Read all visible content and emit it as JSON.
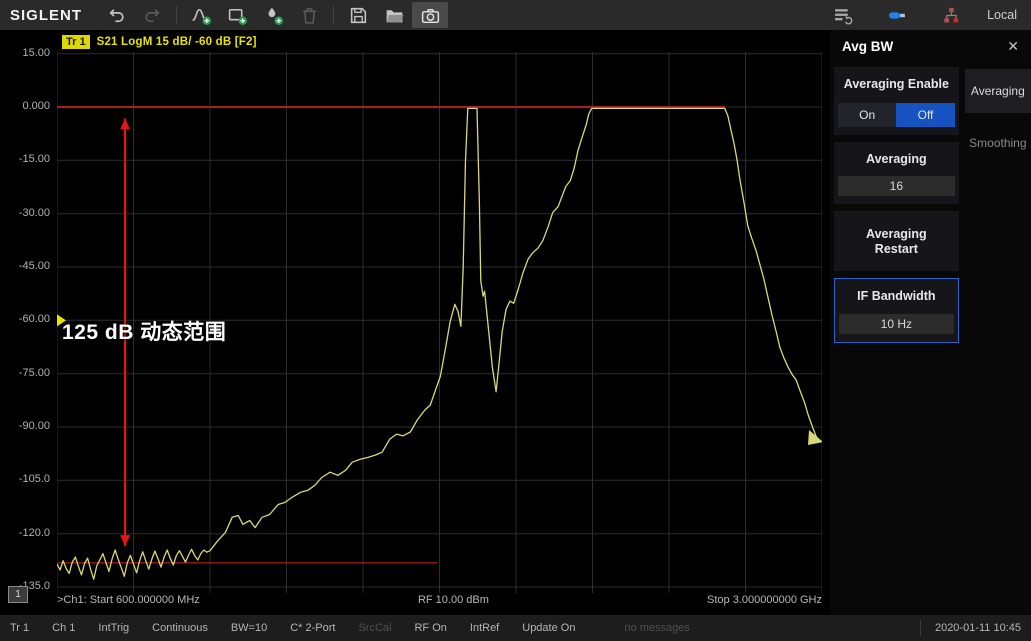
{
  "window": {
    "brand": "SIGLENT",
    "local_label": "Local"
  },
  "toolbar": {
    "icons": [
      "undo",
      "redo",
      "add-trace",
      "add-window",
      "add-marker",
      "delete",
      "save",
      "open-file",
      "screenshot"
    ],
    "right_icons": [
      "system-setup",
      "usb",
      "lan-error"
    ]
  },
  "trace_info": {
    "badge": "Tr 1",
    "text": "S21 LogM 15 dB/ -60 dB [F2]"
  },
  "plot": {
    "y_ticks": [
      "15.00",
      "0.000",
      "-15.00",
      "-30.00",
      "-45.00",
      "-60.00",
      "-75.00",
      "-90.00",
      "-105.0",
      "-120.0",
      "-135.0"
    ],
    "annotation_label": "125 dB 动态范围",
    "channel_badge": "1",
    "footer": {
      "start": ">Ch1: Start 600.000000 MHz",
      "power": "RF 10.00 dBm",
      "stop": "Stop 3.000000000 GHz"
    }
  },
  "chart_data": {
    "type": "line",
    "title": "Tr 1 S21 LogM 15 dB/ -60 dB [F2]",
    "x_range": {
      "start": "600.000000 MHz",
      "stop": "3.000000000 GHz"
    },
    "y_axis": {
      "unit": "dB",
      "scale_per_div": 15,
      "ref_level": -60,
      "ticks": [
        15,
        0,
        -15,
        -30,
        -45,
        -60,
        -75,
        -90,
        -105,
        -120,
        -135
      ]
    },
    "grid": {
      "x_divisions": 10,
      "color": "#2d2d2d"
    },
    "series": [
      {
        "name": "Tr1 S21",
        "color": "#d8d878",
        "points": [
          [
            0.0,
            -128.5
          ],
          [
            0.004,
            -130.2
          ],
          [
            0.008,
            -127.6
          ],
          [
            0.012,
            -129.8
          ],
          [
            0.016,
            -131.2
          ],
          [
            0.02,
            -128.0
          ],
          [
            0.024,
            -126.6
          ],
          [
            0.028,
            -129.2
          ],
          [
            0.032,
            -131.6
          ],
          [
            0.036,
            -128.4
          ],
          [
            0.04,
            -126.9
          ],
          [
            0.044,
            -130.1
          ],
          [
            0.048,
            -132.8
          ],
          [
            0.052,
            -129.0
          ],
          [
            0.056,
            -127.4
          ],
          [
            0.06,
            -125.6
          ],
          [
            0.064,
            -128.2
          ],
          [
            0.068,
            -130.6
          ],
          [
            0.072,
            -127.1
          ],
          [
            0.076,
            -124.6
          ],
          [
            0.08,
            -127.2
          ],
          [
            0.084,
            -129.6
          ],
          [
            0.088,
            -132.0
          ],
          [
            0.092,
            -128.1
          ],
          [
            0.096,
            -126.1
          ],
          [
            0.1,
            -128.6
          ],
          [
            0.104,
            -131.0
          ],
          [
            0.108,
            -127.6
          ],
          [
            0.112,
            -125.1
          ],
          [
            0.116,
            -127.6
          ],
          [
            0.12,
            -130.0
          ],
          [
            0.124,
            -127.1
          ],
          [
            0.128,
            -124.9
          ],
          [
            0.132,
            -127.0
          ],
          [
            0.136,
            -129.4
          ],
          [
            0.14,
            -126.6
          ],
          [
            0.144,
            -124.6
          ],
          [
            0.148,
            -126.9
          ],
          [
            0.152,
            -128.8
          ],
          [
            0.156,
            -126.2
          ],
          [
            0.16,
            -124.8
          ],
          [
            0.164,
            -126.4
          ],
          [
            0.168,
            -128.0
          ],
          [
            0.172,
            -126.0
          ],
          [
            0.176,
            -124.4
          ],
          [
            0.18,
            -126.2
          ],
          [
            0.184,
            -127.4
          ],
          [
            0.188,
            -125.6
          ],
          [
            0.192,
            -124.6
          ],
          [
            0.196,
            -125.2
          ],
          [
            0.2,
            -124.8
          ],
          [
            0.21,
            -122.0
          ],
          [
            0.22,
            -119.7
          ],
          [
            0.229,
            -115.4
          ],
          [
            0.237,
            -114.9
          ],
          [
            0.243,
            -117.4
          ],
          [
            0.252,
            -116.3
          ],
          [
            0.259,
            -118.3
          ],
          [
            0.268,
            -115.4
          ],
          [
            0.278,
            -114.6
          ],
          [
            0.289,
            -111.8
          ],
          [
            0.298,
            -111.2
          ],
          [
            0.307,
            -109.8
          ],
          [
            0.318,
            -108.4
          ],
          [
            0.328,
            -107.8
          ],
          [
            0.337,
            -106.4
          ],
          [
            0.346,
            -104.2
          ],
          [
            0.357,
            -102.7
          ],
          [
            0.367,
            -103.6
          ],
          [
            0.377,
            -102.2
          ],
          [
            0.386,
            -99.9
          ],
          [
            0.396,
            -99.1
          ],
          [
            0.407,
            -98.5
          ],
          [
            0.416,
            -97.9
          ],
          [
            0.425,
            -97.1
          ],
          [
            0.435,
            -93.4
          ],
          [
            0.444,
            -92.0
          ],
          [
            0.452,
            -92.5
          ],
          [
            0.462,
            -91.4
          ],
          [
            0.471,
            -88.0
          ],
          [
            0.481,
            -85.2
          ],
          [
            0.488,
            -83.8
          ],
          [
            0.494,
            -80.1
          ],
          [
            0.501,
            -75.8
          ],
          [
            0.507,
            -68.8
          ],
          [
            0.514,
            -60.3
          ],
          [
            0.52,
            -55.5
          ],
          [
            0.524,
            -57.4
          ],
          [
            0.528,
            -61.7
          ],
          [
            0.531,
            -45.0
          ],
          [
            0.534,
            -15.0
          ],
          [
            0.537,
            -0.4
          ],
          [
            0.549,
            -0.4
          ],
          [
            0.552,
            -26.0
          ],
          [
            0.554,
            -49.0
          ],
          [
            0.557,
            -53.2
          ],
          [
            0.559,
            -51.8
          ],
          [
            0.563,
            -60.3
          ],
          [
            0.569,
            -73.0
          ],
          [
            0.574,
            -80.1
          ],
          [
            0.578,
            -71.6
          ],
          [
            0.582,
            -63.1
          ],
          [
            0.587,
            -56.9
          ],
          [
            0.592,
            -54.6
          ],
          [
            0.597,
            -55.2
          ],
          [
            0.603,
            -51.2
          ],
          [
            0.609,
            -46.7
          ],
          [
            0.616,
            -42.7
          ],
          [
            0.622,
            -41.0
          ],
          [
            0.629,
            -39.6
          ],
          [
            0.635,
            -37.6
          ],
          [
            0.642,
            -33.7
          ],
          [
            0.648,
            -29.7
          ],
          [
            0.655,
            -28.0
          ],
          [
            0.66,
            -25.2
          ],
          [
            0.665,
            -22.4
          ],
          [
            0.671,
            -20.7
          ],
          [
            0.676,
            -17.3
          ],
          [
            0.681,
            -12.2
          ],
          [
            0.686,
            -8.8
          ],
          [
            0.692,
            -4.8
          ],
          [
            0.695,
            -2.0
          ],
          [
            0.699,
            -0.4
          ],
          [
            0.873,
            -0.4
          ],
          [
            0.877,
            -2.5
          ],
          [
            0.881,
            -6.5
          ],
          [
            0.885,
            -10.2
          ],
          [
            0.889,
            -15.0
          ],
          [
            0.893,
            -20.7
          ],
          [
            0.898,
            -26.9
          ],
          [
            0.903,
            -33.4
          ],
          [
            0.908,
            -36.8
          ],
          [
            0.914,
            -40.5
          ],
          [
            0.919,
            -44.4
          ],
          [
            0.924,
            -48.4
          ],
          [
            0.929,
            -53.2
          ],
          [
            0.935,
            -58.9
          ],
          [
            0.94,
            -63.1
          ],
          [
            0.945,
            -67.6
          ],
          [
            0.95,
            -70.5
          ],
          [
            0.956,
            -73.3
          ],
          [
            0.961,
            -75.3
          ],
          [
            0.966,
            -76.7
          ],
          [
            0.971,
            -79.6
          ],
          [
            0.977,
            -83.0
          ],
          [
            0.982,
            -86.6
          ],
          [
            0.987,
            -89.7
          ],
          [
            0.992,
            -92.5
          ],
          [
            0.997,
            -94.2
          ]
        ]
      }
    ],
    "overlays": {
      "ref_line": {
        "dB": 0,
        "x_from": 0,
        "x_to": 0.873,
        "color": "#a32020"
      },
      "floor_line": {
        "dB": -128.2,
        "x_from": 0,
        "x_to": 0.497,
        "color": "#a32020"
      },
      "dynamic_range_arrow": {
        "x": 0.089,
        "dB_top": -3.2,
        "dB_bottom": -123.5,
        "color": "#e01818",
        "label": "125 dB 动态范围"
      },
      "ref_marker": {
        "dB": -60,
        "symbol": "triangle-right",
        "color": "#e8e400"
      }
    }
  },
  "panel": {
    "title": "Avg BW",
    "close_icon": "✕",
    "sections": {
      "averaging_enable": {
        "label": "Averaging Enable",
        "on": "On",
        "off": "Off",
        "selected": "Off"
      },
      "averaging": {
        "label": "Averaging",
        "value": "16"
      },
      "averaging_restart": {
        "label": "Averaging Restart"
      },
      "if_bandwidth": {
        "label": "IF Bandwidth",
        "value": "10 Hz"
      }
    },
    "tabs": [
      {
        "label": "Averaging",
        "active": true
      },
      {
        "label": "Smoothing",
        "active": false
      }
    ]
  },
  "status_bar": {
    "items": [
      {
        "label": "Tr 1"
      },
      {
        "label": "Ch 1"
      },
      {
        "label": "IntTrig"
      },
      {
        "label": "Continuous"
      },
      {
        "label": "BW=10"
      },
      {
        "label": "C* 2-Port"
      },
      {
        "label": "SrcCal",
        "dim": true
      },
      {
        "label": "RF On"
      },
      {
        "label": "IntRef"
      },
      {
        "label": "Update On"
      },
      {
        "label": "no messages",
        "dim": true,
        "gap": true
      }
    ],
    "datetime": "2020-01-11 10:45"
  }
}
